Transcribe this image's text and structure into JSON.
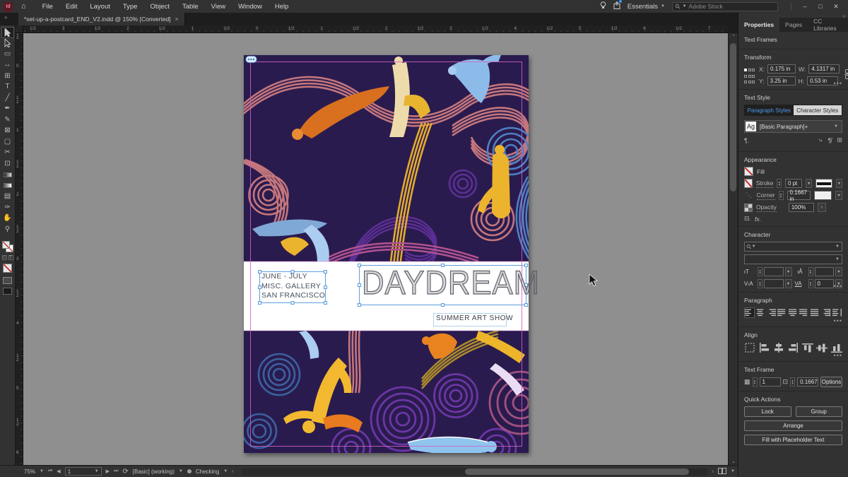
{
  "app": {
    "logo_text": "Id",
    "menus": [
      "File",
      "Edit",
      "Layout",
      "Type",
      "Object",
      "Table",
      "View",
      "Window",
      "Help"
    ],
    "workspace": "Essentials",
    "search_placeholder": "Adobe Stock"
  },
  "doc_tab": {
    "title": "*set-up-a-postcard_END_V2.indd @ 150% [Converted]",
    "close_glyph": "×"
  },
  "rulers": {
    "h_labels": [
      "1/2",
      "3",
      "1/2",
      "2",
      "1/2",
      "1",
      "1/2",
      "0",
      "1/2",
      "1",
      "1/2",
      "2",
      "1/2",
      "3",
      "1/2",
      "4",
      "1/2",
      "5",
      "1/2",
      "6",
      "1/2",
      "7"
    ],
    "v_labels": [
      "1/2",
      "0",
      "1/2",
      "1",
      "1/2",
      "2",
      "1/2",
      "3",
      "1/2",
      "4",
      "1/2",
      "5",
      "1/2",
      "6"
    ]
  },
  "toolbar": {
    "tools": [
      {
        "name": "selection-tool",
        "glyph": "arrow-filled",
        "active": true
      },
      {
        "name": "direct-selection-tool",
        "glyph": "arrow-hollow",
        "active": false
      },
      {
        "name": "page-tool",
        "glyph": "▭",
        "active": false
      },
      {
        "name": "gap-tool",
        "glyph": "↔",
        "active": false
      },
      {
        "name": "content-collector-tool",
        "glyph": "⊞",
        "active": false
      },
      {
        "name": "type-tool",
        "glyph": "T",
        "active": false
      },
      {
        "name": "line-tool",
        "glyph": "╱",
        "active": false
      },
      {
        "name": "pen-tool",
        "glyph": "✒",
        "active": false
      },
      {
        "name": "pencil-tool",
        "glyph": "✎",
        "active": false
      },
      {
        "name": "frame-tool",
        "glyph": "⊠",
        "active": false
      },
      {
        "name": "rectangle-tool",
        "glyph": "▢",
        "active": false
      },
      {
        "name": "scissors-tool",
        "glyph": "✂",
        "active": false
      },
      {
        "name": "free-transform-tool",
        "glyph": "⊡",
        "active": false
      },
      {
        "name": "gradient-swatch-tool",
        "glyph": "gradient",
        "active": false
      },
      {
        "name": "gradient-feather-tool",
        "glyph": "gradient-light",
        "active": false
      },
      {
        "name": "note-tool",
        "glyph": "▤",
        "active": false
      },
      {
        "name": "eyedropper-tool",
        "glyph": "✑",
        "active": false
      },
      {
        "name": "hand-tool",
        "glyph": "✋",
        "active": false
      },
      {
        "name": "zoom-tool",
        "glyph": "⚲",
        "active": false
      }
    ]
  },
  "panel": {
    "tabs": [
      {
        "label": "Properties",
        "active": true
      },
      {
        "label": "Pages",
        "active": false
      },
      {
        "label": "CC Libraries",
        "active": false
      }
    ],
    "selection_type": "Text Frames",
    "transform": {
      "title": "Transform",
      "x_label": "X:",
      "x_value": "0.175 in",
      "y_label": "Y:",
      "y_value": "3.25 in",
      "w_label": "W:",
      "w_value": "4.1317 in",
      "h_label": "H:",
      "h_value": "0.53 in"
    },
    "text_style": {
      "title": "Text Style",
      "tabs": [
        "Paragraph Styles",
        "Character Styles"
      ],
      "sample_glyph": "Ag",
      "style_value": "[Basic Paragraph]+"
    },
    "appearance": {
      "title": "Appearance",
      "fill_label": "Fill",
      "stroke_label": "Stroke",
      "stroke_value": "0 pt",
      "corner_label": "Corner",
      "corner_value": "0.1667 in",
      "opacity_label": "Opacity",
      "opacity_value": "100%",
      "fx_label": "fx."
    },
    "character": {
      "title": "Character",
      "tracking_value": "0"
    },
    "paragraph": {
      "title": "Paragraph",
      "align_icons": [
        "align-left",
        "align-center",
        "align-right",
        "justify-last-left",
        "justify-last-center",
        "justify-last-right",
        "justify-all",
        "align-toward-spine",
        "align-away-spine"
      ]
    },
    "align": {
      "title": "Align",
      "icons": [
        "align-left-edges",
        "align-horizontal-centers",
        "align-right-edges",
        "align-top-edges",
        "align-vertical-centers",
        "align-bottom-edges"
      ]
    },
    "text_frame": {
      "title": "Text Frame",
      "columns_value": "1",
      "gutter_value": "0.1667",
      "options_label": "Options"
    },
    "quick_actions": {
      "title": "Quick Actions",
      "buttons": [
        "Lock",
        "Group",
        "Arrange",
        "Fill with Placeholder Text"
      ]
    }
  },
  "canvas": {
    "postcard": {
      "info_lines": [
        "JUNE - JULY",
        "MISC. GALLERY",
        "SAN FRANCISCO"
      ],
      "title": "DAYDREAM",
      "subtitle": "SUMMER ART SHOW"
    }
  },
  "statusbar": {
    "zoom": "75%",
    "page": "1",
    "preflight_profile": "[Basic] (working)",
    "preflight_status": "Checking"
  },
  "colors": {
    "accent_blue": "#4e9be8",
    "selection_handle": "#4a90d9",
    "guide_magenta": "#d05fc5",
    "artwork_navy": "#2a1b4e",
    "none_swatch_red": "#c92a2a"
  }
}
